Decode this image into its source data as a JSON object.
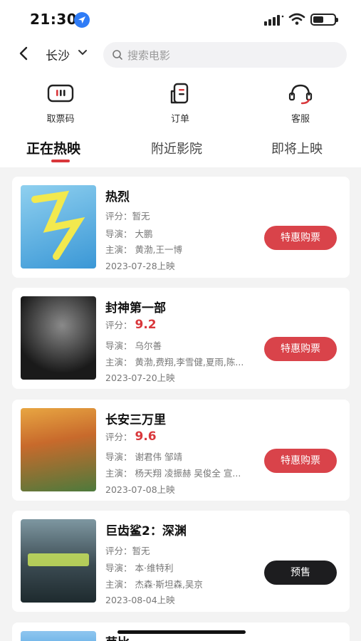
{
  "status_bar": {
    "time": "21:30"
  },
  "nav": {
    "city": "长沙",
    "search_placeholder": "搜索电影"
  },
  "quick_actions": [
    {
      "label": "取票码",
      "icon": "ticket-code-icon"
    },
    {
      "label": "订单",
      "icon": "order-icon"
    },
    {
      "label": "客服",
      "icon": "customer-service-icon"
    }
  ],
  "tabs": [
    {
      "label": "正在热映",
      "active": true
    },
    {
      "label": "附近影院",
      "active": false
    },
    {
      "label": "即将上映",
      "active": false
    }
  ],
  "movies": [
    {
      "title": "热烈",
      "score_label": "评分：",
      "score": "暂无",
      "director": "导演：  大鹏",
      "cast": "主演：  黄渤,王一博",
      "release": "2023-07-28上映",
      "action": "特惠购票",
      "poster_colors": [
        "#7fc4e8",
        "#3a97d6"
      ]
    },
    {
      "title": "封神第一部",
      "score_label": "评分：",
      "score": "9.2",
      "director": "导演：  乌尔善",
      "cast": "主演：  黄渤,费翔,李雪健,夏雨,陈...",
      "release": "2023-07-20上映",
      "action": "特惠购票",
      "poster_colors": [
        "#5a5a5a",
        "#1c1c1c"
      ]
    },
    {
      "title": "长安三万里",
      "score_label": "评分：",
      "score": "9.6",
      "director": "导演：  谢君伟 邹靖",
      "cast": "主演：  杨天翔 凌振赫 吴俊全 宣...",
      "release": "2023-07-08上映",
      "action": "特惠购票",
      "poster_colors": [
        "#d9822b",
        "#4d7a3c"
      ]
    },
    {
      "title": "巨齿鲨2：深渊",
      "score_label": "评分：",
      "score": "暂无",
      "director": "导演：  本·维特利",
      "cast": "主演：  杰森·斯坦森,吴京",
      "release": "2023-08-04上映",
      "action": "预售",
      "poster_colors": [
        "#6d8a96",
        "#27353c"
      ]
    },
    {
      "title": "芭比",
      "poster_colors": [
        "#8fc6ef",
        "#4aa0e0"
      ]
    }
  ],
  "colors": {
    "accent": "#d9373b",
    "button_red": "#d9434a",
    "button_dark": "#1d1d1f",
    "location_blue": "#2f7cf6"
  }
}
